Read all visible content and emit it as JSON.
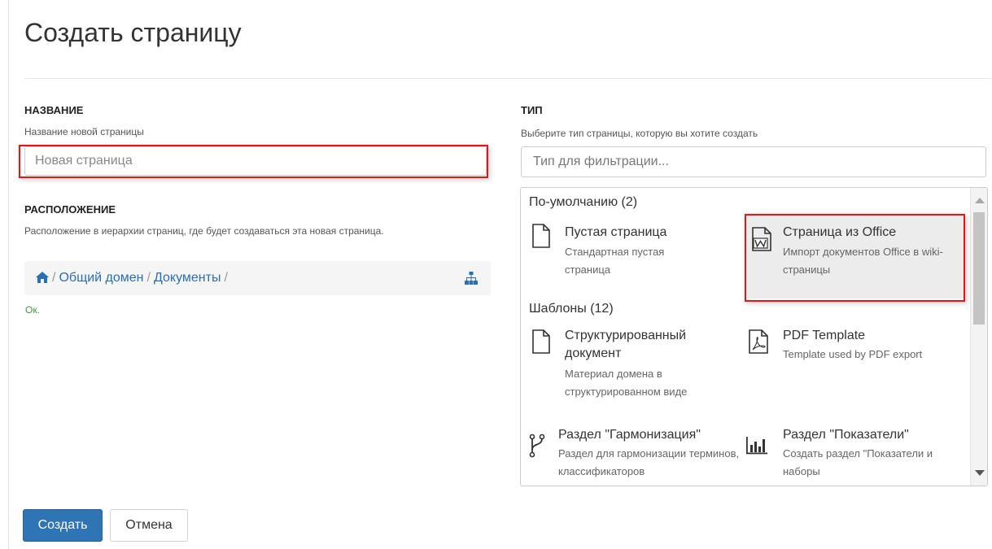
{
  "page_title": "Создать страницу",
  "name_section": {
    "label": "НАЗВАНИЕ",
    "help": "Название новой страницы",
    "input_value": "",
    "input_placeholder": "Новая страница"
  },
  "location_section": {
    "label": "РАСПОЛОЖЕНИЕ",
    "help": "Расположение в иерархии страниц, где будет создаваться эта новая страница.",
    "breadcrumb": [
      "Общий домен",
      "Документы"
    ],
    "separator": "/",
    "status": "Ок."
  },
  "type_section": {
    "label": "ТИП",
    "help": "Выберите тип страницы, которую вы хотите создать",
    "filter_value": "",
    "filter_placeholder": "Тип для фильтрации...",
    "groups": [
      {
        "title": "По-умолчанию (2)",
        "items": [
          {
            "name": "Пустая страница",
            "desc": "Стандартная пустая страница",
            "icon": "blank-page-icon"
          },
          {
            "name": "Страница из Office",
            "desc": "Импорт документов Office в wiki-страницы",
            "icon": "word-document-icon",
            "selected": true
          }
        ]
      },
      {
        "title": "Шаблоны (12)",
        "items": [
          {
            "name": "Структурированный документ",
            "desc": "Материал домена в структурированном виде",
            "icon": "blank-page-icon"
          },
          {
            "name": "PDF Template",
            "desc": "Template used by PDF export",
            "icon": "pdf-icon"
          },
          {
            "name": "Раздел \"Гармонизация\"",
            "desc": "Раздел для гармонизации терминов, классификаторов",
            "icon": "branch-icon"
          },
          {
            "name": "Раздел \"Показатели\"",
            "desc": "Создать раздел \"Показатели и наборы",
            "icon": "bar-chart-icon"
          }
        ]
      }
    ]
  },
  "buttons": {
    "create": "Создать",
    "cancel": "Отмена"
  },
  "colors": {
    "primary": "#2f74b5",
    "link": "#2a6eb5",
    "ok": "#3a9e3a",
    "highlight": "#ee1111"
  }
}
